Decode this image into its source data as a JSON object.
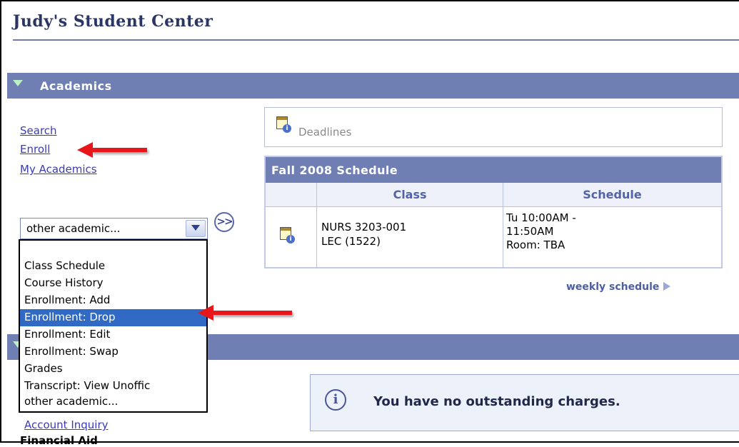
{
  "header": {
    "title": "Judy's Student Center"
  },
  "academics": {
    "section_title": "Academics",
    "links": [
      "Search",
      "Enroll",
      "My Academics"
    ],
    "select": {
      "value": "other academic...",
      "options": [
        "Class Schedule",
        "Course History",
        "Enrollment: Add",
        "Enrollment: Drop",
        "Enrollment: Edit",
        "Enrollment: Swap",
        "Grades",
        "Transcript: View Unoffic",
        "other academic..."
      ],
      "highlighted": "Enrollment: Drop"
    },
    "deadlines_label": "Deadlines",
    "schedule": {
      "title": "Fall 2008 Schedule",
      "columns": [
        "",
        "Class",
        "Schedule"
      ],
      "rows": [
        {
          "class_line1": "NURS 3203-001",
          "class_line2": "LEC (1522)",
          "schedule_line1": "Tu 10:00AM -",
          "schedule_line2": "11:50AM",
          "schedule_line3": "Room:  TBA"
        }
      ],
      "weekly_link": "weekly schedule"
    }
  },
  "finances": {
    "partial_link": "Account Inquiry",
    "financial_aid_label": "Financial Aid",
    "charges_message": "You have no outstanding charges."
  },
  "colors": {
    "section_header": "#6f7eb3",
    "arrow": "#e8151a",
    "link": "#3b3bb8",
    "selected_option": "#316ac5"
  },
  "icons": [
    "triangle-down-icon",
    "calendar-info-icon",
    "dropdown-arrow-icon",
    "go-icon",
    "info-icon",
    "play-triangle-icon"
  ]
}
